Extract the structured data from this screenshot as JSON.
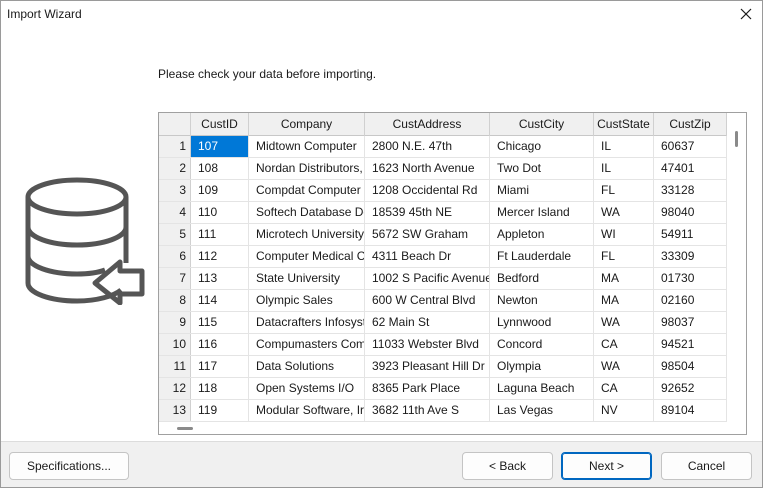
{
  "window": {
    "title": "Import Wizard"
  },
  "instruction": "Please check your data before importing.",
  "icons": {
    "close": "close-icon",
    "database_import": "database-import-icon"
  },
  "grid": {
    "columns": [
      "CustID",
      "Company",
      "CustAddress",
      "CustCity",
      "CustState",
      "CustZip"
    ],
    "rows": [
      {
        "num": "1",
        "cells": [
          "107",
          "Midtown Computer",
          "2800 N.E. 47th",
          "Chicago",
          "IL",
          "60637"
        ]
      },
      {
        "num": "2",
        "cells": [
          "108",
          "Nordan Distributors,",
          "1623 North Avenue",
          "Two Dot",
          "IL",
          "47401"
        ]
      },
      {
        "num": "3",
        "cells": [
          "109",
          "Compdat Computer",
          "1208 Occidental Rd",
          "Miami",
          "FL",
          "33128"
        ]
      },
      {
        "num": "4",
        "cells": [
          "110",
          "Softech Database De",
          "18539 45th NE",
          "Mercer Island",
          "WA",
          "98040"
        ]
      },
      {
        "num": "5",
        "cells": [
          "111",
          "Microtech University",
          "5672 SW Graham",
          "Appleton",
          "WI",
          "54911"
        ]
      },
      {
        "num": "6",
        "cells": [
          "112",
          "Computer Medical C",
          "4311 Beach Dr",
          "Ft Lauderdale",
          "FL",
          "33309"
        ]
      },
      {
        "num": "7",
        "cells": [
          "113",
          "State University",
          "1002 S Pacific Avenue",
          "Bedford",
          "MA",
          "01730"
        ]
      },
      {
        "num": "8",
        "cells": [
          "114",
          "Olympic Sales",
          "600 W Central Blvd",
          "Newton",
          "MA",
          "02160"
        ]
      },
      {
        "num": "9",
        "cells": [
          "115",
          "Datacrafters Infosyst",
          "62 Main St",
          "Lynnwood",
          "WA",
          "98037"
        ]
      },
      {
        "num": "10",
        "cells": [
          "116",
          "Compumasters Com",
          "11033 Webster Blvd",
          "Concord",
          "CA",
          "94521"
        ]
      },
      {
        "num": "11",
        "cells": [
          "117",
          "Data Solutions",
          "3923 Pleasant Hill Dr",
          "Olympia",
          "WA",
          "98504"
        ]
      },
      {
        "num": "12",
        "cells": [
          "118",
          "Open Systems I/O",
          "8365 Park Place",
          "Laguna Beach",
          "CA",
          "92652"
        ]
      },
      {
        "num": "13",
        "cells": [
          "119",
          "Modular Software, Ir",
          "3682 11th Ave S",
          "Las Vegas",
          "NV",
          "89104"
        ]
      }
    ]
  },
  "buttons": {
    "specifications": "Specifications...",
    "back": "< Back",
    "next": "Next >",
    "cancel": "Cancel"
  },
  "colors": {
    "selection": "#0078d7",
    "primary_border": "#0067c0",
    "footer_bg": "#f0f0f0"
  }
}
